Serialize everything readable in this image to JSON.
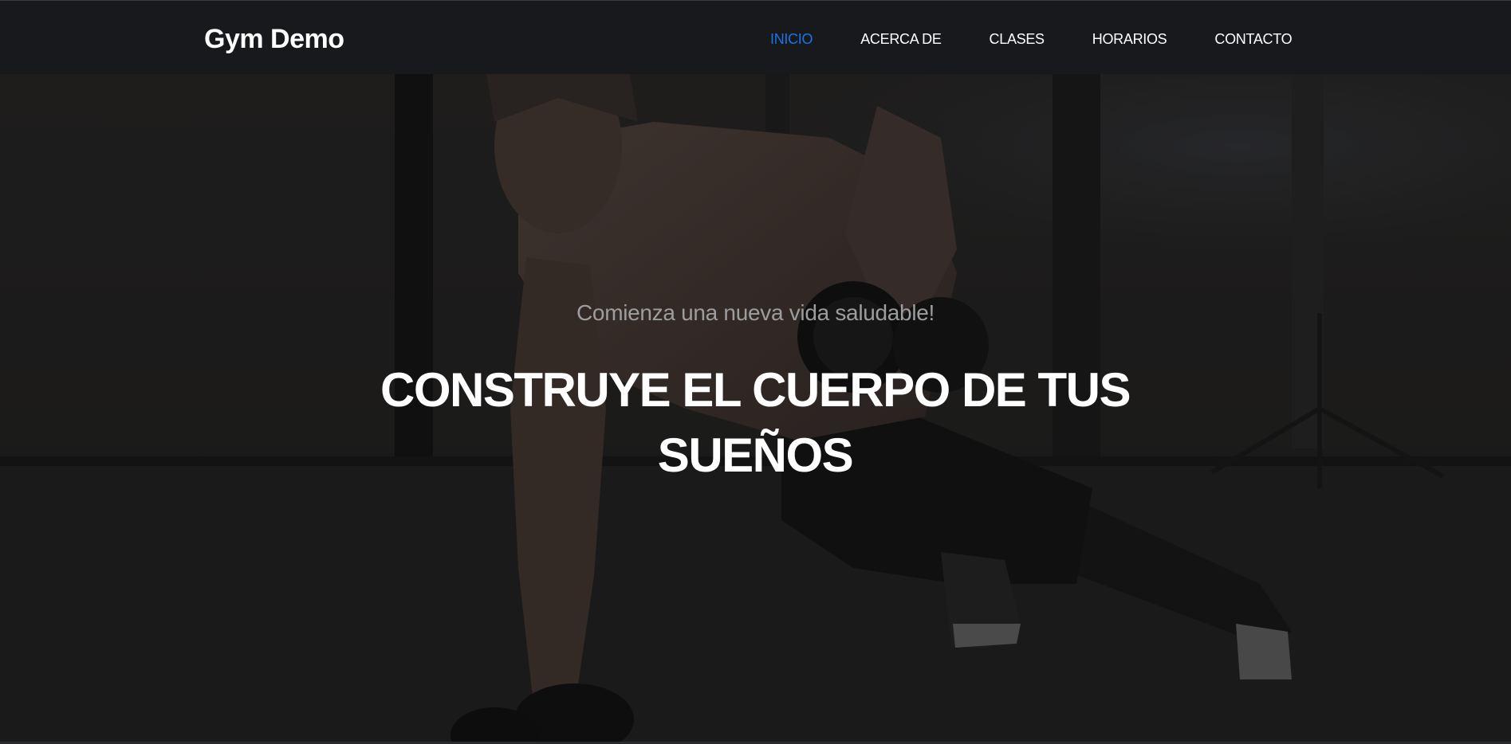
{
  "brand": {
    "name": "Gym Demo"
  },
  "nav": {
    "items": [
      {
        "label": "INICIO",
        "active": true
      },
      {
        "label": "ACERCA DE",
        "active": false
      },
      {
        "label": "CLASES",
        "active": false
      },
      {
        "label": "HORARIOS",
        "active": false
      },
      {
        "label": "CONTACTO",
        "active": false
      }
    ]
  },
  "hero": {
    "subtitle": "Comienza una nueva vida saludable!",
    "title": "CONSTRUYE EL CUERPO DE TUS SUEÑOS",
    "background": "athlete-dumbbell-row-photo"
  },
  "colors": {
    "navbar_bg": "#17191c",
    "accent": "#1a73e8",
    "text": "#ffffff",
    "subtitle": "#9c9d9f"
  }
}
